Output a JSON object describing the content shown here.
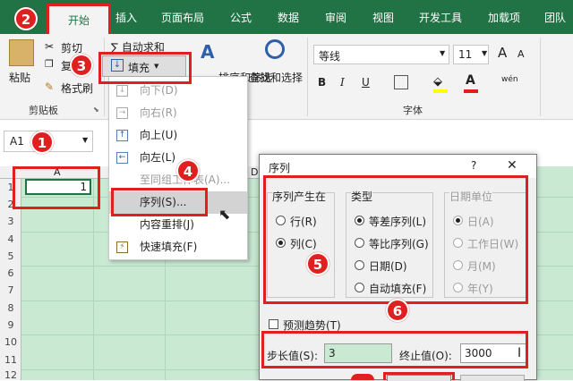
{
  "tabs": {
    "home": "开始",
    "insert": "插入",
    "layout": "页面布局",
    "formulas": "公式",
    "data": "数据",
    "review": "审阅",
    "view": "视图",
    "developer": "开发工具",
    "addins": "加载项",
    "team": "团队"
  },
  "clipboard": {
    "paste": "粘贴",
    "cut": "剪切",
    "copy": "复",
    "format_painter": "格式刷",
    "group_label": "剪贴板"
  },
  "editing": {
    "autosum": "∑ 自动求和",
    "fill": "填充",
    "sort": "排序和筛选",
    "find": "查找和选择"
  },
  "font": {
    "name": "等线",
    "size": "11",
    "group_label": "字体",
    "bold": "B",
    "italic": "I",
    "underline": "U",
    "grow": "A",
    "shrink": "A",
    "wen": "wén"
  },
  "namebox": {
    "value": "A1"
  },
  "sheet": {
    "col_a": "A",
    "col_d": "D",
    "cell_a1": "1",
    "rows": [
      "1",
      "2",
      "3",
      "4",
      "5",
      "6",
      "7",
      "8",
      "9",
      "10",
      "11",
      "12"
    ]
  },
  "menu": {
    "items": [
      {
        "label": "向下(D)",
        "disabled": true
      },
      {
        "label": "向右(R)",
        "disabled": true
      },
      {
        "label": "向上(U)",
        "disabled": false
      },
      {
        "label": "向左(L)",
        "disabled": false
      },
      {
        "label": "至同组工作表(A)...",
        "disabled": true
      },
      {
        "label": "序列(S)...",
        "disabled": false
      },
      {
        "label": "内容重排(J)",
        "disabled": false
      },
      {
        "label": "快速填充(F)",
        "disabled": false
      }
    ]
  },
  "dialog": {
    "title": "序列",
    "help": "?",
    "close": "✕",
    "series_in": {
      "label": "序列产生在",
      "row": "行(R)",
      "col": "列(C)"
    },
    "type": {
      "label": "类型",
      "linear": "等差序列(L)",
      "growth": "等比序列(G)",
      "date": "日期(D)",
      "autofill": "自动填充(F)"
    },
    "date_unit": {
      "label": "日期单位",
      "day": "日(A)",
      "weekday": "工作日(W)",
      "month": "月(M)",
      "year": "年(Y)"
    },
    "trend": "预测趋势(T)",
    "step_label": "步长值(S):",
    "step_value": "3",
    "stop_label": "终止值(O):",
    "stop_value": "3000"
  },
  "badges": [
    "1",
    "2",
    "3",
    "4",
    "5",
    "6"
  ]
}
